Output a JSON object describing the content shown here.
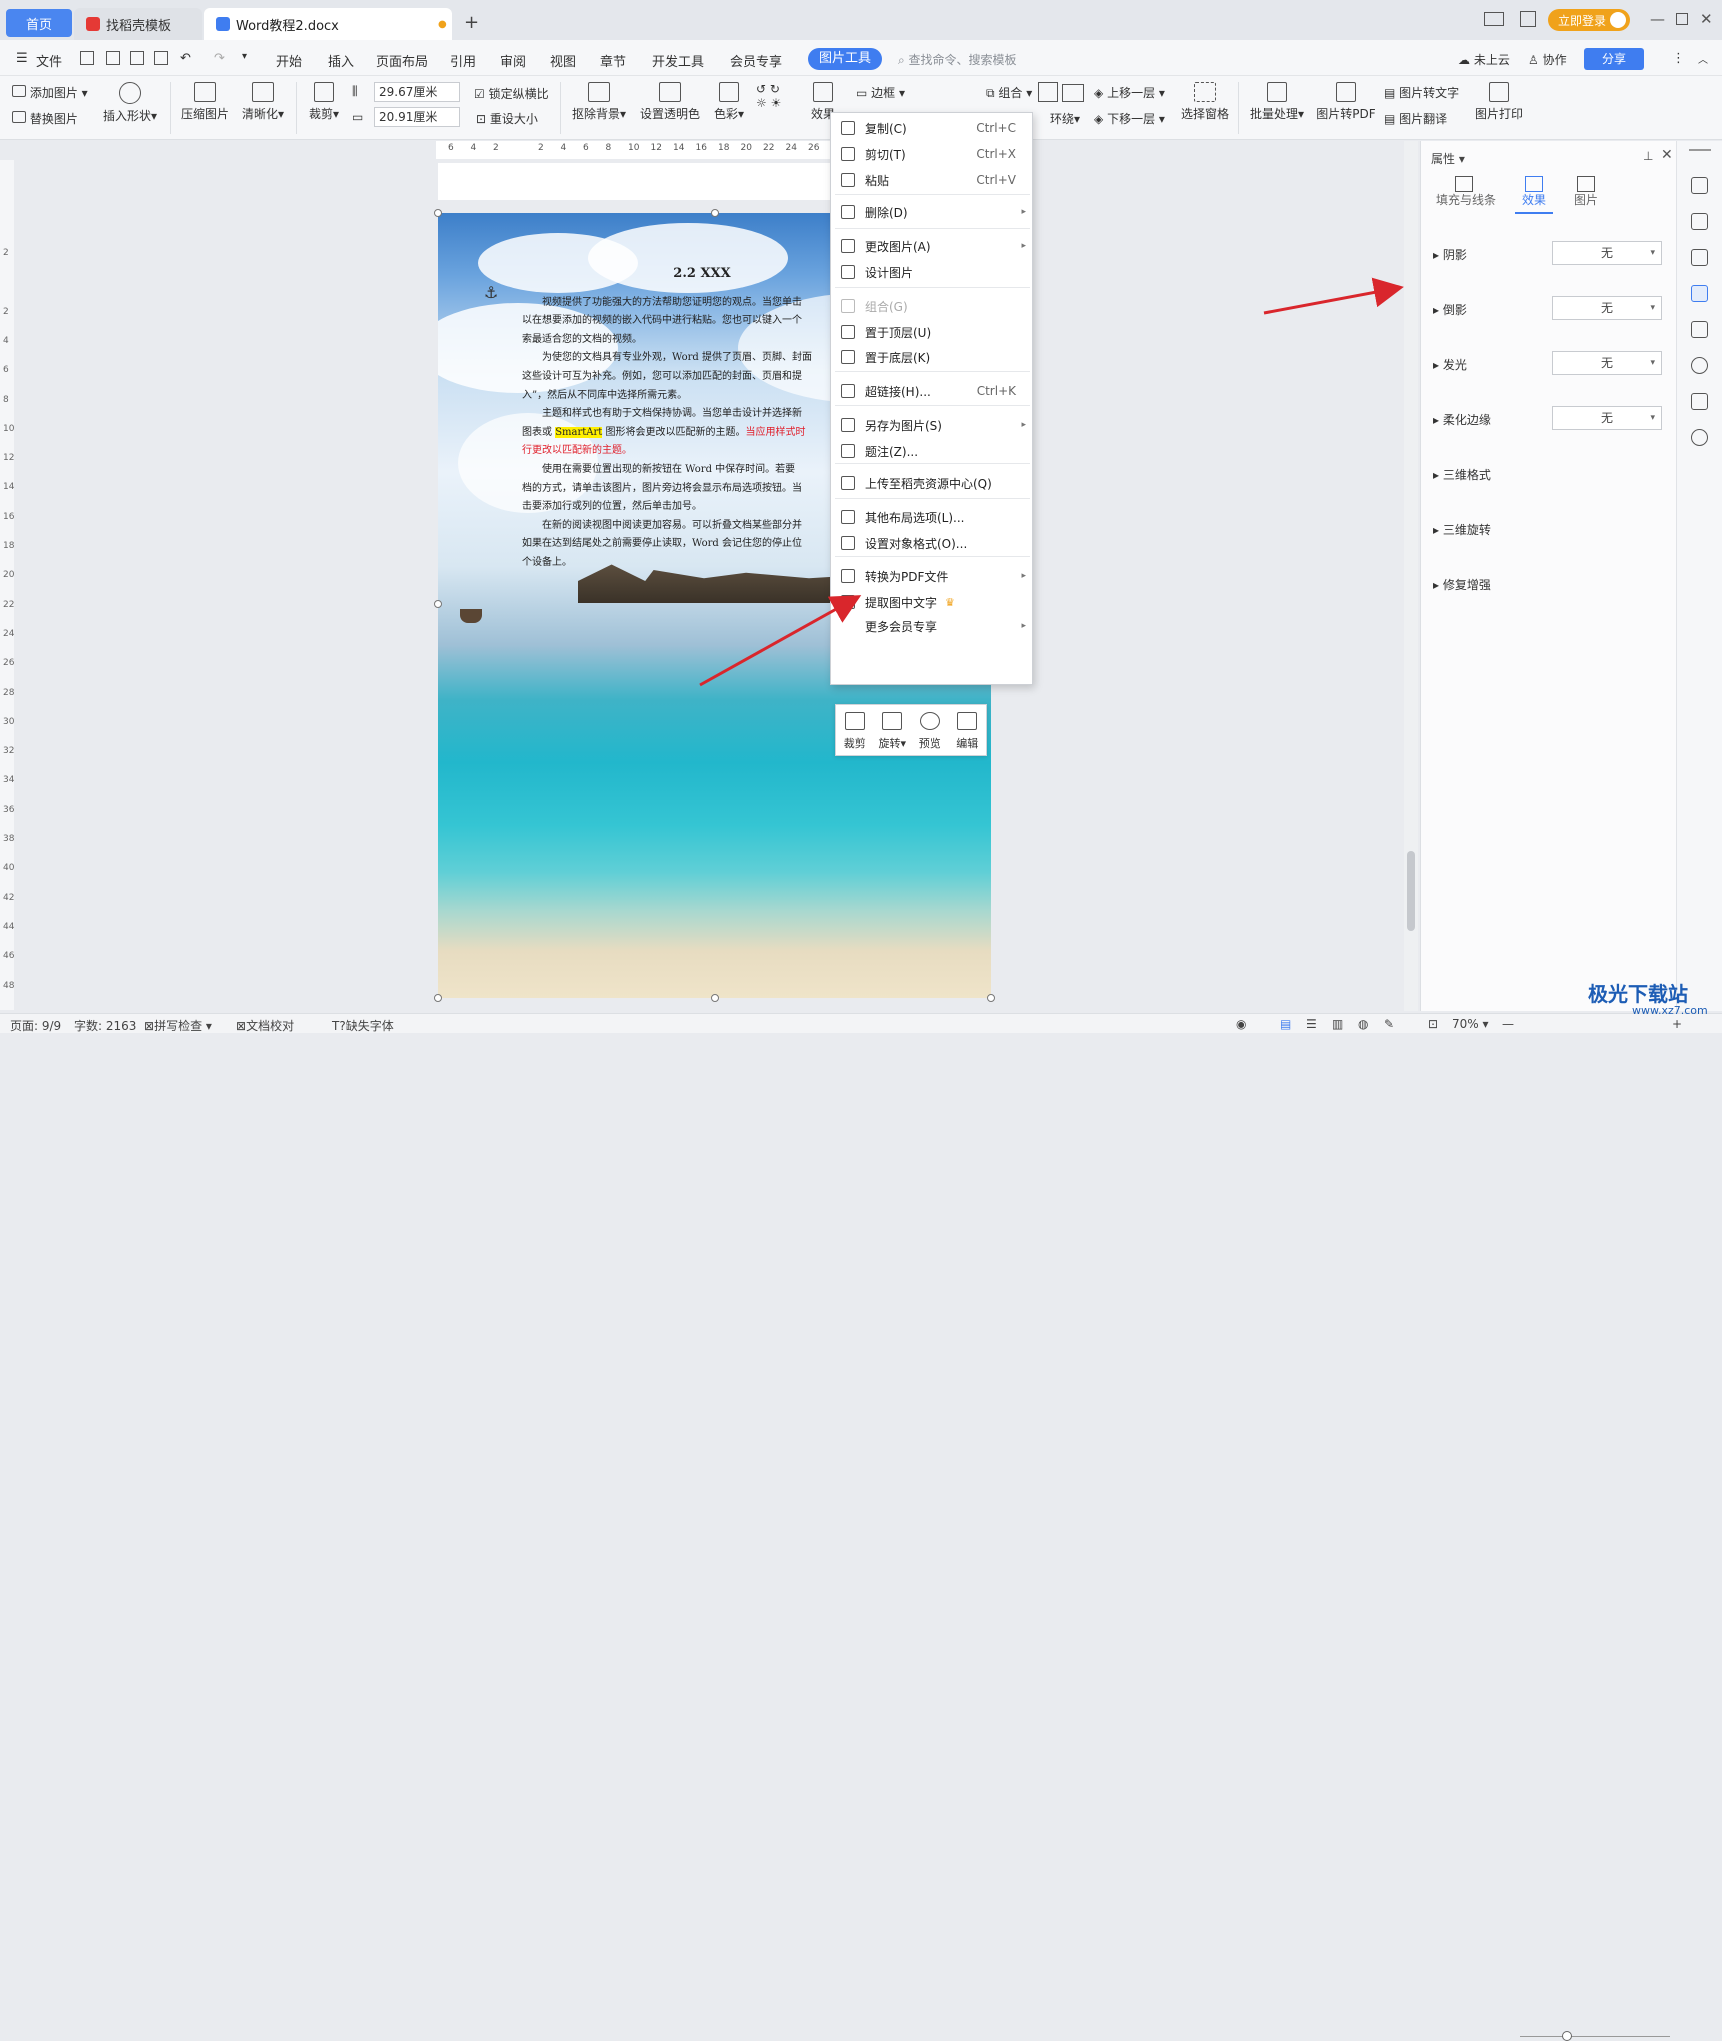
{
  "titlebar": {
    "tab_home": "首页",
    "tab_template": "找稻壳模板",
    "tab_doc": "Word教程2.docx",
    "login": "立即登录",
    "new_tab": "+"
  },
  "menubar": {
    "file": "文件",
    "items": [
      "开始",
      "插入",
      "页面布局",
      "引用",
      "审阅",
      "视图",
      "章节",
      "开发工具",
      "会员专享"
    ],
    "active": "图片工具",
    "search": "查找命令、搜索模板",
    "cloud": "未上云",
    "collab": "协作",
    "share": "分享"
  },
  "ribbon": {
    "add_picture": "添加图片",
    "replace_picture": "替换图片",
    "insert_shape": "插入形状",
    "compress": "压缩图片",
    "sharpen": "清晰化",
    "crop": "裁剪",
    "height": "29.67厘米",
    "width": "20.91厘米",
    "lock_ratio": "锁定纵横比",
    "reset_size": "重设大小",
    "remove_bg": "抠除背景",
    "set_transparent": "设置透明色",
    "color": "色彩",
    "effect": "效果",
    "border": "边框",
    "combine": "组合",
    "wrap": "环绕",
    "bring_forward": "上移一层",
    "send_backward": "下移一层",
    "selection_pane": "选择窗格",
    "batch": "批量处理",
    "to_pdf": "图片转PDF",
    "to_text": "图片转文字",
    "translate": "图片翻译",
    "print": "图片打印"
  },
  "ruler_ticks": [
    "6",
    "4",
    "2",
    "",
    "2",
    "4",
    "6",
    "8",
    "10",
    "12",
    "14",
    "16",
    "18",
    "20",
    "22",
    "24",
    "26"
  ],
  "vruler_ticks": [
    "2",
    "",
    "2",
    "4",
    "6",
    "8",
    "10",
    "12",
    "14",
    "16",
    "18",
    "20",
    "22",
    "24",
    "26",
    "28",
    "30",
    "32",
    "34",
    "36",
    "38",
    "40",
    "42",
    "44",
    "46",
    "48"
  ],
  "document": {
    "heading": "2.2 XXX",
    "p1": [
      "视频提供了功能强大的方法帮助您证明您的观点。当您单击",
      "以在想要添加的视频的嵌入代码中进行粘贴。您也可以键入一个",
      "索最适合您的文档的视频。"
    ],
    "p2": [
      "为使您的文档具有专业外观，Word 提供了页眉、页脚、封面",
      "这些设计可互为补充。例如，您可以添加匹配的封面、页眉和提",
      "入”，然后从不同库中选择所需元素。"
    ],
    "p3_a": "主题和样式也有助于文档保持协调。当您单击设计并选择新",
    "p3_b1": "图表或 ",
    "p3_b2": "SmartArt",
    "p3_b3": " 图形将会更改以匹配新的主题。",
    "p3_b4": "当应用样式时",
    "p3_c": "行更改以匹配新的主题。",
    "p4": [
      "使用在需要位置出现的新按钮在 Word 中保存时间。若要",
      "档的方式，请单击该图片，图片旁边将会显示布局选项按钮。当",
      "击要添加行或列的位置，然后单击加号。"
    ],
    "p5": [
      "在新的阅读视图中阅读更加容易。可以折叠文档某些部分并",
      "如果在达到结尾处之前需要停止读取，Word 会记住您的停止位",
      "个设备上。"
    ]
  },
  "mini_toolbar": [
    "裁剪",
    "旋转",
    "预览",
    "编辑"
  ],
  "context_menu": [
    {
      "label": "复制(C)",
      "shortcut": "Ctrl+C",
      "icon": "copy-icon"
    },
    {
      "label": "剪切(T)",
      "shortcut": "Ctrl+X",
      "icon": "cut-icon"
    },
    {
      "label": "粘贴",
      "shortcut": "Ctrl+V",
      "icon": "paste-icon"
    },
    {
      "label": "删除(D)",
      "shortcut": "",
      "icon": "delete-icon",
      "arrow": true
    },
    {
      "label": "更改图片(A)",
      "shortcut": "",
      "icon": "change-picture-icon",
      "arrow": true
    },
    {
      "label": "设计图片",
      "shortcut": "",
      "icon": "design-picture-icon"
    },
    {
      "label": "组合(G)",
      "shortcut": "",
      "icon": "group-icon",
      "disabled": true
    },
    {
      "label": "置于顶层(U)",
      "shortcut": "",
      "icon": "bring-to-front-icon"
    },
    {
      "label": "置于底层(K)",
      "shortcut": "",
      "icon": "send-to-back-icon"
    },
    {
      "label": "超链接(H)...",
      "shortcut": "Ctrl+K",
      "icon": "hyperlink-icon"
    },
    {
      "label": "另存为图片(S)",
      "shortcut": "",
      "icon": "save-as-picture-icon",
      "arrow": true
    },
    {
      "label": "题注(Z)...",
      "shortcut": "",
      "icon": "caption-icon"
    },
    {
      "label": "上传至稻壳资源中心(Q)",
      "shortcut": "",
      "icon": "upload-icon"
    },
    {
      "label": "其他布局选项(L)...",
      "shortcut": "",
      "icon": "layout-options-icon"
    },
    {
      "label": "设置对象格式(O)...",
      "shortcut": "",
      "icon": "format-object-icon"
    },
    {
      "label": "转换为PDF文件",
      "shortcut": "",
      "icon": "convert-pdf-icon",
      "arrow": true
    },
    {
      "label": "提取图中文字",
      "shortcut": "",
      "icon": "extract-text-icon"
    },
    {
      "label": "更多会员专享",
      "shortcut": "",
      "icon": "",
      "arrow": true
    }
  ],
  "panel": {
    "title": "属性",
    "tabs": [
      "填充与线条",
      "效果",
      "图片"
    ],
    "rows": [
      {
        "label": "阴影",
        "value": "无"
      },
      {
        "label": "倒影",
        "value": "无"
      },
      {
        "label": "发光",
        "value": "无"
      },
      {
        "label": "柔化边缘",
        "value": "无"
      },
      {
        "label": "三维格式"
      },
      {
        "label": "三维旋转"
      },
      {
        "label": "修复增强"
      }
    ]
  },
  "status": {
    "page": "页面: 9/9",
    "words": "字数: 2163",
    "spell": "拼写检查",
    "proofread": "文档校对",
    "missing_font": "缺失字体",
    "zoom": "70%"
  },
  "watermark": {
    "title": "极光下载站",
    "url": "www.xz7.com"
  },
  "colors": {
    "accent": "#3f7df0",
    "login": "#f0a21b",
    "arrow": "#d9262c"
  }
}
